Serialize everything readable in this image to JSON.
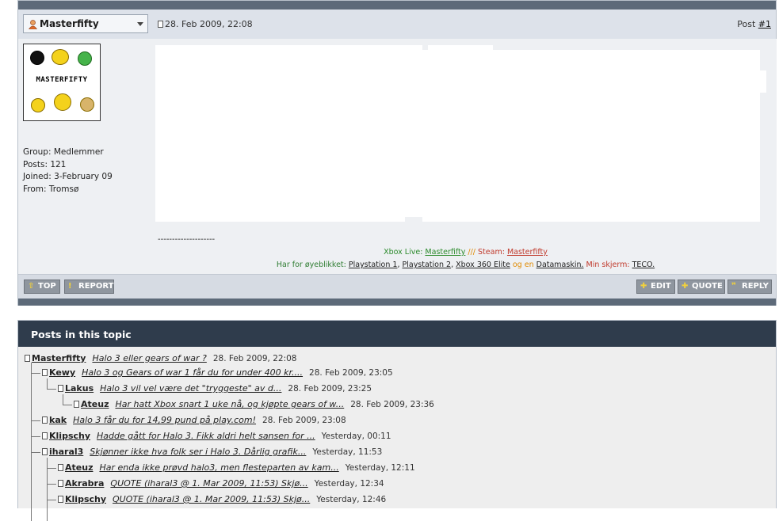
{
  "post": {
    "username": "Masterfifty",
    "date": "28. Feb 2009, 22:08",
    "post_label": "Post ",
    "post_number": "#1",
    "avatar_text": "MASTERFIFTY",
    "user_info": {
      "group": "Group: Medlemmer",
      "posts": "Posts: 121",
      "joined": "Joined: 3-February 09",
      "from": "From: Tromsø"
    },
    "signature": {
      "dashes": "--------------------",
      "line1": {
        "xbox_label": "Xbox Live: ",
        "xbox_name": "Masterfifty",
        "sep": " /// ",
        "steam_label": "Steam: ",
        "steam_name": "Masterfifty"
      },
      "line2": {
        "prefix": "Har for øyeblikket: ",
        "item1": "Playstation 1",
        "c1": ", ",
        "item2": "Playstation 2",
        "c2": ", ",
        "item3": "Xbox 360 Elite",
        "og": " og en ",
        "item4": "Datamaskin.",
        "screen_label": " Min skjerm: ",
        "screen": "TECO."
      }
    },
    "buttons": {
      "top": "TOP",
      "report": "REPORT",
      "edit": "EDIT",
      "quote": "QUOTE",
      "reply": "REPLY"
    }
  },
  "topic": {
    "title": "Posts in this topic",
    "rows": [
      {
        "user": "Masterfifty",
        "subject": "Halo 3 eller gears of war ?",
        "date": "28. Feb 2009, 22:08"
      },
      {
        "user": "Kewy",
        "subject": "Halo 3 og Gears of war 1 får du for under 400 kr....",
        "date": "28. Feb 2009, 23:05"
      },
      {
        "user": "Lakus",
        "subject": "Halo 3 vil vel være det \"tryggeste\" av d...",
        "date": "28. Feb 2009, 23:25"
      },
      {
        "user": "Ateuz",
        "subject": "Har hatt Xbox snart 1 uke nå, og kjøpte gears of w...",
        "date": "28. Feb 2009, 23:36"
      },
      {
        "user": "kak",
        "subject": "Halo 3 får du for 14,99 pund på play.com!",
        "date": "28. Feb 2009, 23:08"
      },
      {
        "user": "Klipschy",
        "subject": "Hadde gått for Halo 3. Fikk aldri helt sansen for ...",
        "date": "Yesterday, 00:11"
      },
      {
        "user": "iharal3",
        "subject": "Skjønner ikke hva folk ser i Halo 3. Dårlig grafik...",
        "date": "Yesterday, 11:53"
      },
      {
        "user": "Ateuz",
        "subject": "Har enda ikke prøvd halo3, men flesteparten av kam...",
        "date": "Yesterday, 12:11"
      },
      {
        "user": "Akrabra",
        "subject": "QUOTE (iharal3 @ 1. Mar 2009, 11:53) Skjø...",
        "date": "Yesterday, 12:34"
      },
      {
        "user": "Klipschy",
        "subject": "QUOTE (iharal3 @ 1. Mar 2009, 11:53) Skjø...",
        "date": "Yesterday, 12:46"
      }
    ]
  }
}
